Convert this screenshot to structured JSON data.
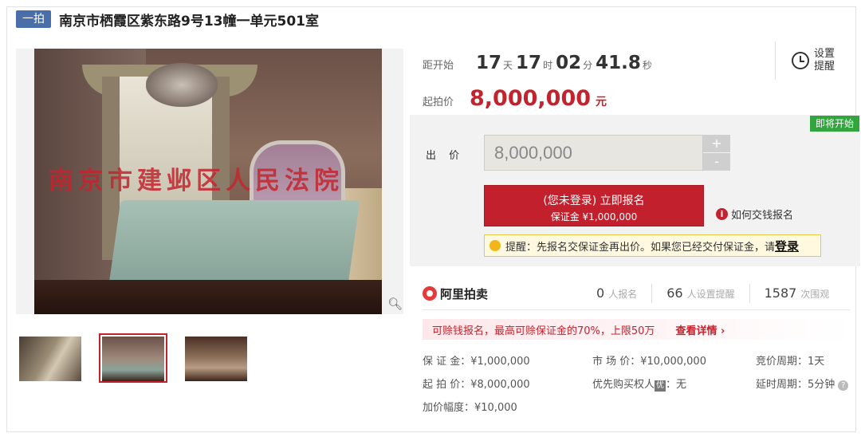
{
  "header": {
    "tag": "一拍",
    "title": "南京市栖霞区紫东路9号13幢一单元501室"
  },
  "gallery": {
    "watermark": "南京市建邺区人民法院",
    "zoom_icon": "magnifier-icon",
    "thumbs": [
      "kitchen",
      "bedroom",
      "dining-room"
    ],
    "selected": 1
  },
  "countdown": {
    "label": "距开始",
    "days": "17",
    "days_unit": "天",
    "hours": "17",
    "hours_unit": "时",
    "minutes": "02",
    "minutes_unit": "分",
    "seconds": "41.8",
    "seconds_unit": "秒"
  },
  "reminder": {
    "label": "设置提醒",
    "icon": "clock-icon"
  },
  "start_price": {
    "label": "起拍价",
    "value": "8,000,000",
    "unit": "元"
  },
  "bid": {
    "status_badge": "即将开始",
    "label": "出 价",
    "value": "8,000,000",
    "plus": "+",
    "minus": "-",
    "signup_line1": "(您未登录) 立即报名",
    "signup_line2": "保证金 ¥1,000,000",
    "howpay": "如何交钱报名",
    "tip_prefix": "提醒：先报名交保证金再出价。如果您已经交付保证金，请",
    "tip_login": "登录"
  },
  "brand": {
    "name": "阿里拍卖"
  },
  "stats": [
    {
      "n": "0",
      "t": "人报名"
    },
    {
      "n": "66",
      "t": "人设置提醒"
    },
    {
      "n": "1587",
      "t": "次围观"
    }
  ],
  "promo": {
    "text": "可赊钱报名，最高可赊保证金的70%，上限50万",
    "more": "查看详情 ›"
  },
  "details": {
    "deposit": "保 证 金：¥1,000,000",
    "market_price": "市 场 价：¥10,000,000",
    "cycle": "竞价周期：1天",
    "start_price": "起 拍 价：¥8,000,000",
    "priority_prefix": "优先购买权人",
    "priority_badge": "优",
    "priority_value": "：无",
    "delay": "延时周期：5分钟",
    "increment": "加价幅度：¥10,000"
  },
  "colors": {
    "accent": "#c4232d",
    "tag": "#4a6ea9",
    "badge": "#32a53e"
  }
}
